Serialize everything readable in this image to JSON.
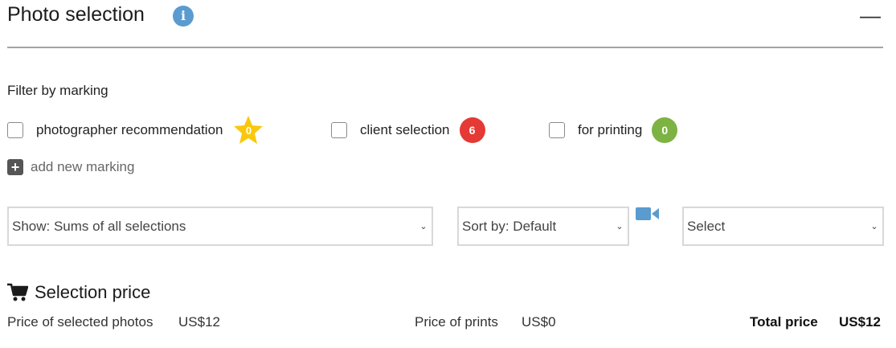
{
  "header": {
    "title": "Photo selection",
    "info_icon": "info-icon",
    "collapse_icon": "minus-icon"
  },
  "filter": {
    "label": "Filter by marking",
    "items": [
      {
        "label": "photographer recommendation",
        "count": "0",
        "badge_shape": "star",
        "color": "#f9c80e",
        "checked": false
      },
      {
        "label": "client selection",
        "count": "6",
        "badge_shape": "circle",
        "color": "#e53935",
        "checked": false
      },
      {
        "label": "for printing",
        "count": "0",
        "badge_shape": "circle",
        "color": "#7cb342",
        "checked": false
      }
    ],
    "add_marking_label": "add new marking"
  },
  "controls": {
    "show_select": "Show: Sums of all selections",
    "sort_select": "Sort by: Default",
    "video_icon": "video-camera-icon",
    "action_select": "Select"
  },
  "price": {
    "heading": "Selection price",
    "selected_photos_label": "Price of selected photos",
    "selected_photos_value": "US$12",
    "prints_label": "Price of prints",
    "prints_value": "US$0",
    "total_label": "Total price",
    "total_value": "US$12"
  },
  "colors": {
    "info_blue": "#5a9bd0",
    "camera_blue": "#5a9bd0"
  }
}
